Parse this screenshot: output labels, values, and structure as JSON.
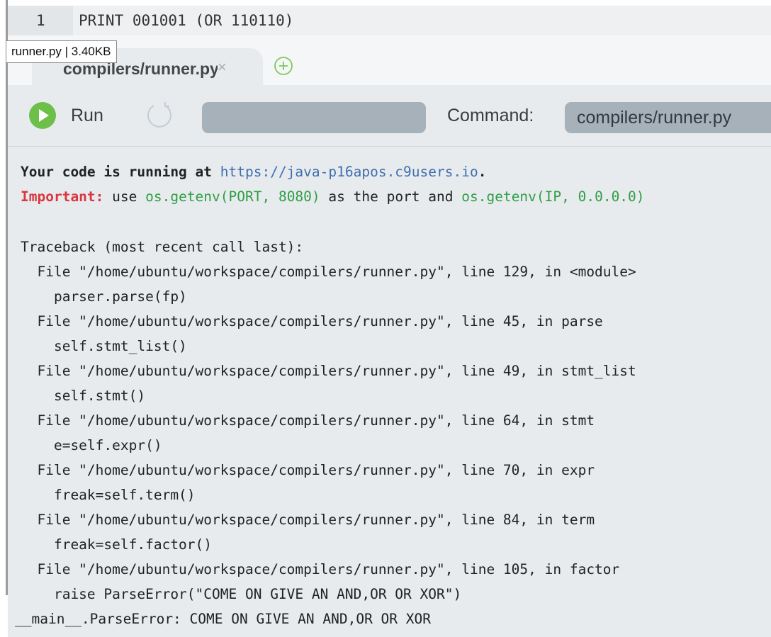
{
  "editor": {
    "line_number": "1",
    "code": "PRINT 001001 (OR 110110)"
  },
  "tooltip": {
    "text": "runner.py | 3.40KB"
  },
  "tab": {
    "label": "compilers/runner.py",
    "close_glyph": "×"
  },
  "toolbar": {
    "run_label": "Run",
    "command_label": "Command:",
    "command_value": "compilers/runner.py"
  },
  "console": {
    "running_prefix": "Your code is running at ",
    "running_url": "https://java-p16apos.c9users.io",
    "running_suffix": ".",
    "important_label": "Important:",
    "important_use": " use ",
    "port_expr": "os.getenv(PORT, 8080)",
    "important_middle": " as the port and ",
    "ip_expr": "os.getenv(IP, 0.0.0.0)",
    "traceback_lines": [
      "Traceback (most recent call last):",
      "  File \"/home/ubuntu/workspace/compilers/runner.py\", line 129, in <module>",
      "    parser.parse(fp)",
      "  File \"/home/ubuntu/workspace/compilers/runner.py\", line 45, in parse",
      "    self.stmt_list()",
      "  File \"/home/ubuntu/workspace/compilers/runner.py\", line 49, in stmt_list",
      "    self.stmt()",
      "  File \"/home/ubuntu/workspace/compilers/runner.py\", line 64, in stmt",
      "    e=self.expr()",
      "  File \"/home/ubuntu/workspace/compilers/runner.py\", line 70, in expr",
      "    freak=self.term()",
      "  File \"/home/ubuntu/workspace/compilers/runner.py\", line 84, in term",
      "    freak=self.factor()",
      "  File \"/home/ubuntu/workspace/compilers/runner.py\", line 105, in factor",
      "    raise ParseError(\"COME ON GIVE AN AND,OR OR XOR\")",
      "__main__.ParseError: COME ON GIVE AN AND,OR OR XOR"
    ]
  },
  "icons": {
    "run": "play-circle-icon",
    "restart": "restart-icon",
    "add_tab": "plus-circle-icon",
    "close": "close-icon"
  },
  "colors": {
    "run_green": "#6cc04a",
    "important_red": "#d9363e",
    "url_blue": "#3f6fae",
    "env_green": "#2f9e44",
    "panel_bg": "#e7ebee",
    "field_bg": "#a7b1ba"
  }
}
